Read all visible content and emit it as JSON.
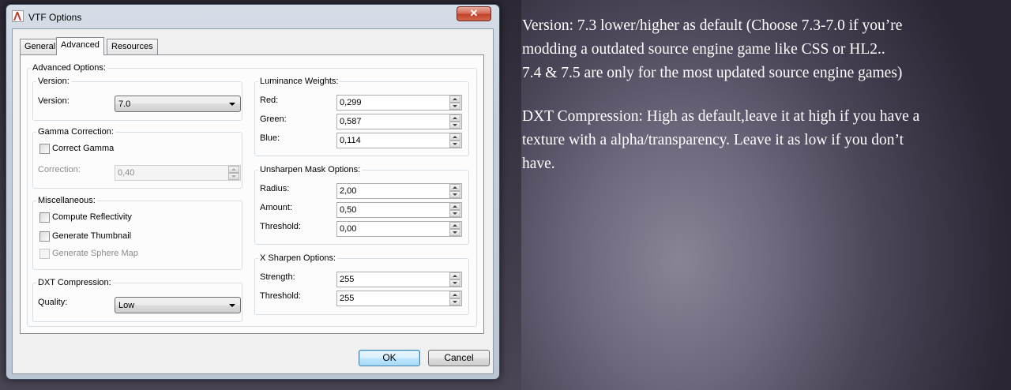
{
  "window": {
    "title": "VTF Options",
    "close_label": "✕"
  },
  "tabs": [
    {
      "label": "General",
      "active": false
    },
    {
      "label": "Advanced",
      "active": true
    },
    {
      "label": "Resources",
      "active": false
    }
  ],
  "advanced": {
    "group_title": "Advanced Options:",
    "version_group": {
      "title": "Version:",
      "label": "Version:",
      "value": "7.0"
    },
    "gamma_group": {
      "title": "Gamma Correction:",
      "correct_gamma_label": "Correct Gamma",
      "correct_gamma_checked": false,
      "correction_label": "Correction:",
      "correction_value": "0,40"
    },
    "misc_group": {
      "title": "Miscellaneous:",
      "compute_reflectivity_label": "Compute Reflectivity",
      "generate_thumbnail_label": "Generate Thumbnail",
      "generate_sphere_map_label": "Generate Sphere Map"
    },
    "dxt_group": {
      "title": "DXT Compression:",
      "quality_label": "Quality:",
      "quality_value": "Low"
    },
    "luminance_group": {
      "title": "Luminance Weights:",
      "red_label": "Red:",
      "red_value": "0,299",
      "green_label": "Green:",
      "green_value": "0,587",
      "blue_label": "Blue:",
      "blue_value": "0,114"
    },
    "unsharpen_group": {
      "title": "Unsharpen Mask Options:",
      "radius_label": "Radius:",
      "radius_value": "2,00",
      "amount_label": "Amount:",
      "amount_value": "0,50",
      "threshold_label": "Threshold:",
      "threshold_value": "0,00"
    },
    "xsharpen_group": {
      "title": "X Sharpen Options:",
      "strength_label": "Strength:",
      "strength_value": "255",
      "threshold_label": "Threshold:",
      "threshold_value": "255"
    }
  },
  "buttons": {
    "ok_label": "OK",
    "cancel_label": "Cancel"
  },
  "caption": {
    "paragraph1": "Version: 7.3 lower/higher as default (Choose 7.3-7.0 if you’re\nmodding a outdated source engine game like CSS or HL2..\n7.4 & 7.5 are only for the most updated source engine games)",
    "paragraph2": "DXT Compression: High as default,leave it at high if you have a\ntexture with a alpha/transparency. Leave it as low if you don’t\nhave."
  }
}
